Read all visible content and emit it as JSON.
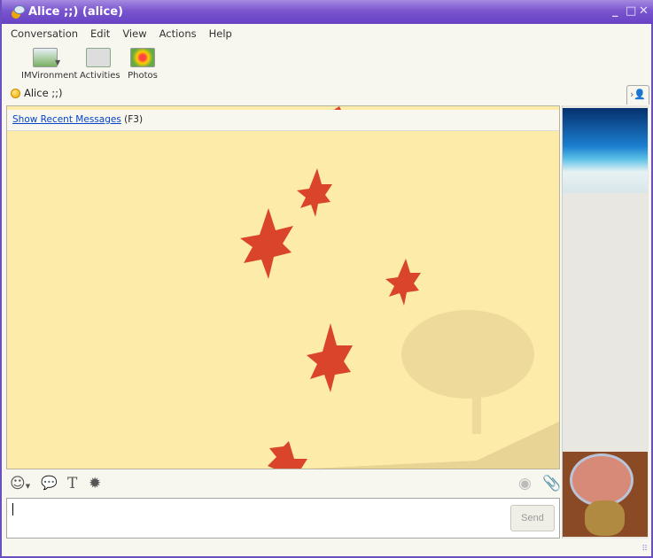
{
  "window": {
    "title": "Alice ;;) (alice)"
  },
  "menu": [
    "Conversation",
    "Edit",
    "View",
    "Actions",
    "Help"
  ],
  "toolbar": [
    {
      "label": "IMVironment",
      "icon": "imvironment-icon"
    },
    {
      "label": "Activities",
      "icon": "activities-icon"
    },
    {
      "label": "Photos",
      "icon": "photos-icon"
    }
  ],
  "contact": {
    "name": "Alice ;;)",
    "status_color": "#f5b400"
  },
  "chat": {
    "recent_link": "Show Recent Messages",
    "recent_shortcut": "(F3)"
  },
  "input": {
    "value": "",
    "send_label": "Send"
  },
  "colors": {
    "title": "#6742c4",
    "chat_bg": "#fdeca9",
    "leaf": "#d9442b"
  }
}
